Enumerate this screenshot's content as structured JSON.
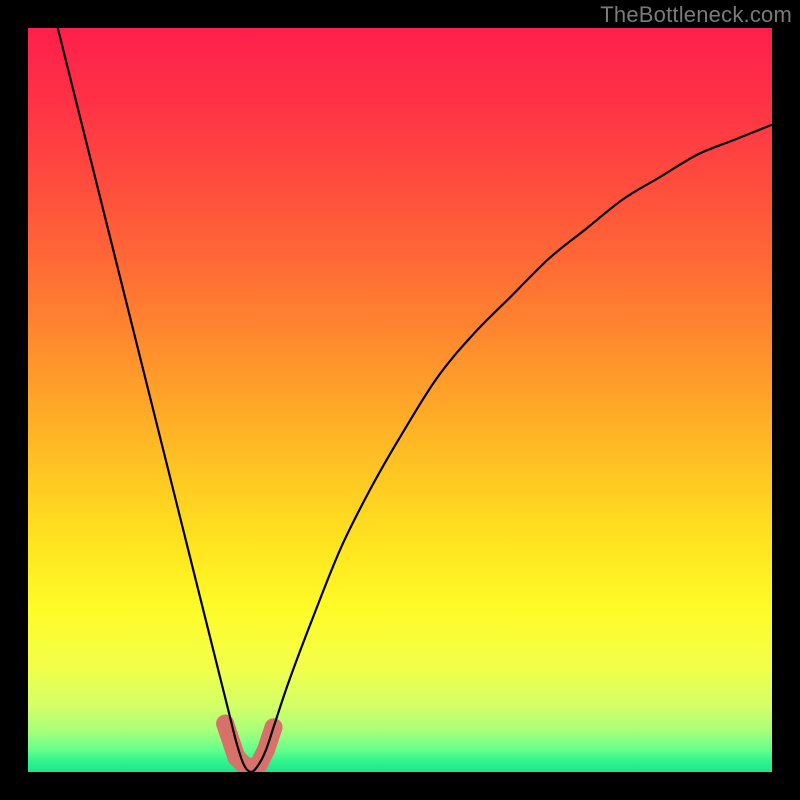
{
  "watermark": "TheBottleneck.com",
  "chart_data": {
    "type": "line",
    "title": "",
    "xlabel": "",
    "ylabel": "",
    "xlim": [
      0,
      100
    ],
    "ylim": [
      0,
      100
    ],
    "series": [
      {
        "name": "bottleneck-curve",
        "color": "#000000",
        "x": [
          4,
          6,
          8,
          10,
          12,
          14,
          16,
          18,
          20,
          22,
          24,
          26,
          27,
          28,
          29,
          30,
          31,
          32,
          33,
          35,
          38,
          42,
          46,
          50,
          55,
          60,
          65,
          70,
          75,
          80,
          85,
          90,
          95,
          100
        ],
        "y": [
          100,
          92,
          84,
          76,
          68,
          60,
          52,
          44,
          36,
          28,
          20,
          12,
          8,
          4,
          1,
          0,
          1,
          3,
          6,
          12,
          20,
          30,
          38,
          45,
          53,
          59,
          64,
          69,
          73,
          77,
          80,
          83,
          85,
          87
        ]
      }
    ],
    "marker_points": {
      "name": "highlight-markers",
      "color": "#d9716b",
      "x": [
        26.5,
        27,
        27.5,
        28,
        29,
        30,
        31,
        32,
        32.5,
        33
      ],
      "y": [
        6.5,
        5,
        3.5,
        2,
        1,
        0.5,
        1,
        3,
        4.5,
        6
      ]
    },
    "background_gradient": {
      "stops": [
        {
          "offset": 0.0,
          "color": "#ff1f4b"
        },
        {
          "offset": 0.1,
          "color": "#ff3246"
        },
        {
          "offset": 0.2,
          "color": "#ff4a3e"
        },
        {
          "offset": 0.3,
          "color": "#ff6536"
        },
        {
          "offset": 0.4,
          "color": "#ff842f"
        },
        {
          "offset": 0.5,
          "color": "#ffa528"
        },
        {
          "offset": 0.6,
          "color": "#ffc722"
        },
        {
          "offset": 0.7,
          "color": "#ffe61f"
        },
        {
          "offset": 0.78,
          "color": "#fffb28"
        },
        {
          "offset": 0.86,
          "color": "#f2ff4a"
        },
        {
          "offset": 0.91,
          "color": "#d4ff66"
        },
        {
          "offset": 0.945,
          "color": "#a7ff7a"
        },
        {
          "offset": 0.97,
          "color": "#66ff8c"
        },
        {
          "offset": 0.985,
          "color": "#33f58c"
        },
        {
          "offset": 1.0,
          "color": "#19e68a"
        }
      ]
    }
  }
}
